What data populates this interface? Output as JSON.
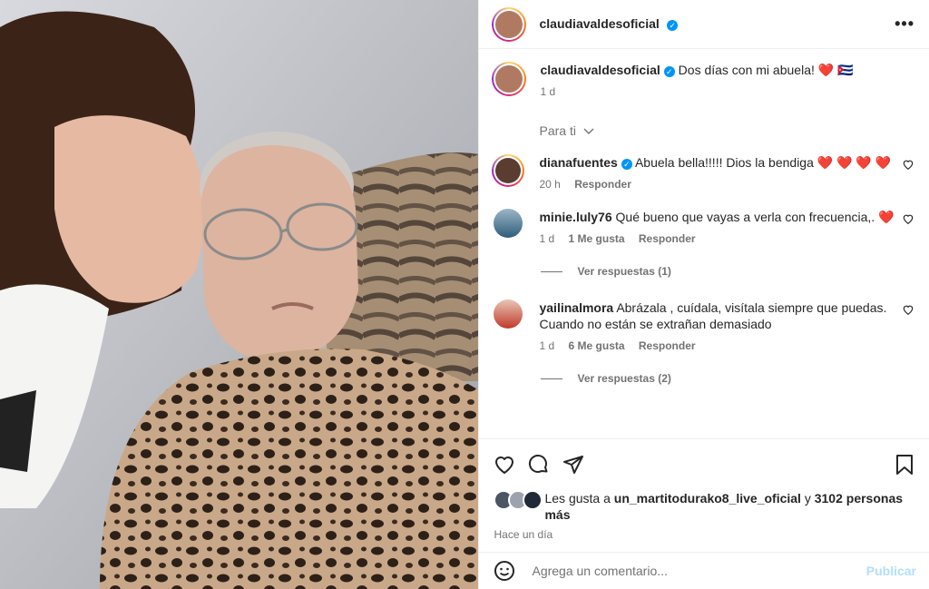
{
  "post": {
    "author": "claudiavaldesoficial",
    "caption_text": "Dos días con mi abuela! ❤️ 🇨🇺",
    "caption_age": "1 d",
    "filter_label": "Para ti",
    "likes_prefix": "Les gusta a",
    "likes_user": "un_martitodurako8_live_oficial",
    "likes_and": "y",
    "likes_others": "3102 personas más",
    "time_ago": "Hace un día",
    "add_placeholder": "Agrega un comentario...",
    "publish_label": "Publicar"
  },
  "comments": [
    {
      "user": "dianafuentes",
      "verified": true,
      "text": "Abuela bella!!!!! Dios la bendiga ❤️ ❤️ ❤️ ❤️",
      "age": "20 h",
      "likes": "",
      "reply": "Responder",
      "view_replies": ""
    },
    {
      "user": "minie.luly76",
      "verified": false,
      "text": "Qué bueno que vayas a verla con frecuencia,. ❤️",
      "age": "1 d",
      "likes": "1 Me gusta",
      "reply": "Responder",
      "view_replies": "Ver respuestas (1)"
    },
    {
      "user": "yailinalmora",
      "verified": false,
      "text": "Abrázala , cuídala, visítala siempre que puedas. Cuando no están se extrañan demasiado",
      "age": "1 d",
      "likes": "6 Me gusta",
      "reply": "Responder",
      "view_replies": "Ver respuestas (2)"
    }
  ],
  "icons": [
    "heart-icon",
    "comment-icon",
    "share-icon",
    "bookmark-icon",
    "emoji-icon",
    "more-icon",
    "verified-icon",
    "chevron-down-icon"
  ],
  "colors": {
    "link_blue": "#0095f6",
    "publish_disabled": "#b2dffc",
    "muted": "#737373",
    "heart_red": "#ed4956"
  }
}
